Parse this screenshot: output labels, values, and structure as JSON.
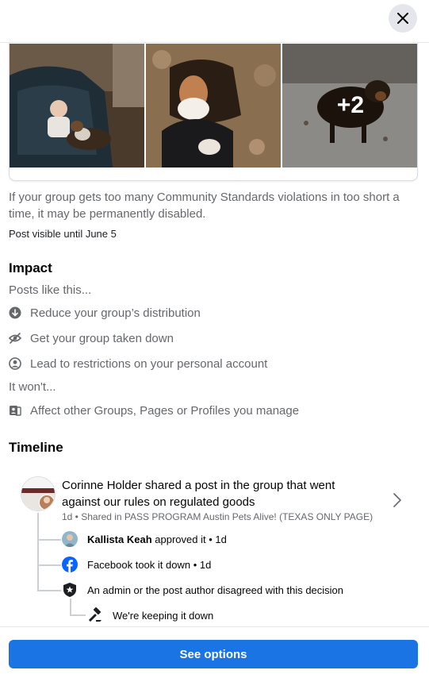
{
  "photos": {
    "more_count": "+2"
  },
  "notice": {
    "description": "If your group gets too many Community Standards violations in too short a time, it may be permanently disabled.",
    "visible_until": "Post visible until June 5"
  },
  "impact": {
    "title": "Impact",
    "posts_like_this": "Posts like this...",
    "items": [
      {
        "icon": "arrow-down-circle-icon",
        "label": "Reduce your group’s distribution"
      },
      {
        "icon": "eye-slash-icon",
        "label": "Get your group taken down"
      },
      {
        "icon": "person-circle-icon",
        "label": "Lead to restrictions on your personal account"
      }
    ],
    "it_wont": "It won't...",
    "wont_items": [
      {
        "icon": "pages-icon",
        "label": "Affect other Groups, Pages or Profiles you manage"
      }
    ]
  },
  "timeline": {
    "title": "Timeline",
    "main_text": "Corinne Holder shared a post in the group that went against our rules on regulated goods",
    "meta": "1d • Shared in PASS PROGRAM Austin Pets Alive! (TEXAS ONLY PAGE)",
    "steps": [
      {
        "bold": "Kallista Keah",
        "text": " approved it • 1d"
      },
      {
        "bold": "",
        "text": "Facebook took it down • 1d"
      },
      {
        "bold": "",
        "text": "An admin or the post author disagreed with this decision"
      },
      {
        "bold": "",
        "text": "We're keeping it down"
      }
    ]
  },
  "footer": {
    "see_options_label": "See options"
  },
  "colors": {
    "accent": "#1b74e4",
    "facebook_blue": "#0866ff",
    "secondary_text": "#65676b"
  }
}
